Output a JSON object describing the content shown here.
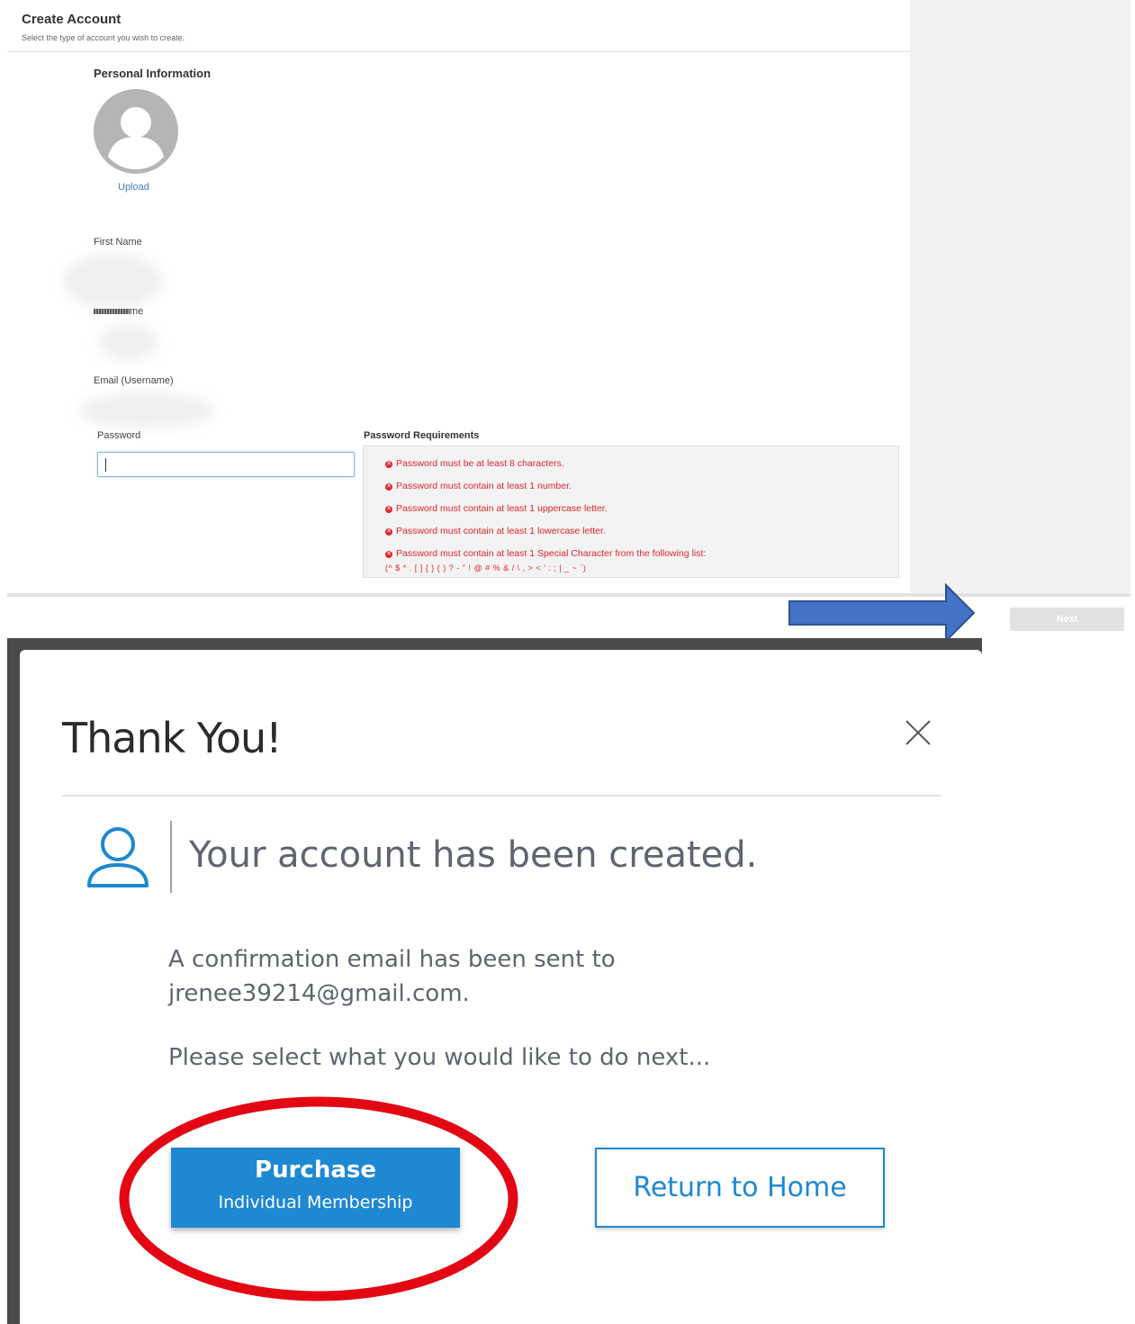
{
  "header": {
    "title": "Create Account",
    "subtitle": "Select the type of account you wish to create."
  },
  "personal_info": {
    "section_title": "Personal Information",
    "upload_label": "Upload"
  },
  "fields": {
    "first_name_label": "First Name",
    "last_name_label": "me",
    "email_label": "Email (Username)",
    "password_label": "Password",
    "password_value": ""
  },
  "password_requirements": {
    "title": "Password Requirements",
    "items": [
      "Password must be at least 8 characters.",
      "Password must contain at least 1 number.",
      "Password must contain at least 1 uppercase letter.",
      "Password must contain at least 1 lowercase letter.",
      "Password must contain at least 1 Special Character from the following list:"
    ],
    "special_chars": "(^ $ * . [ ] { } ( ) ? - \" ! @ # % & / \\ , > < ' : ; | _ ~ `)"
  },
  "footer": {
    "next_label": "Next"
  },
  "modal": {
    "title": "Thank You!",
    "success_message": "Your account has been created.",
    "confirmation_line1": "A confirmation email has been sent to",
    "confirmation_line2": "jrenee39214@gmail.com.",
    "next_prompt": "Please select what you would like to do next...",
    "purchase_label": "Purchase",
    "purchase_sublabel": "Individual Membership",
    "return_home_label": "Return to Home"
  },
  "colors": {
    "accent": "#1e88d2",
    "error": "#e0262f",
    "annotation_arrow": "#4472c4",
    "annotation_circle": "#e30613"
  },
  "icons": [
    "avatar-placeholder-icon",
    "error-x-icon",
    "close-icon",
    "user-outline-icon"
  ]
}
